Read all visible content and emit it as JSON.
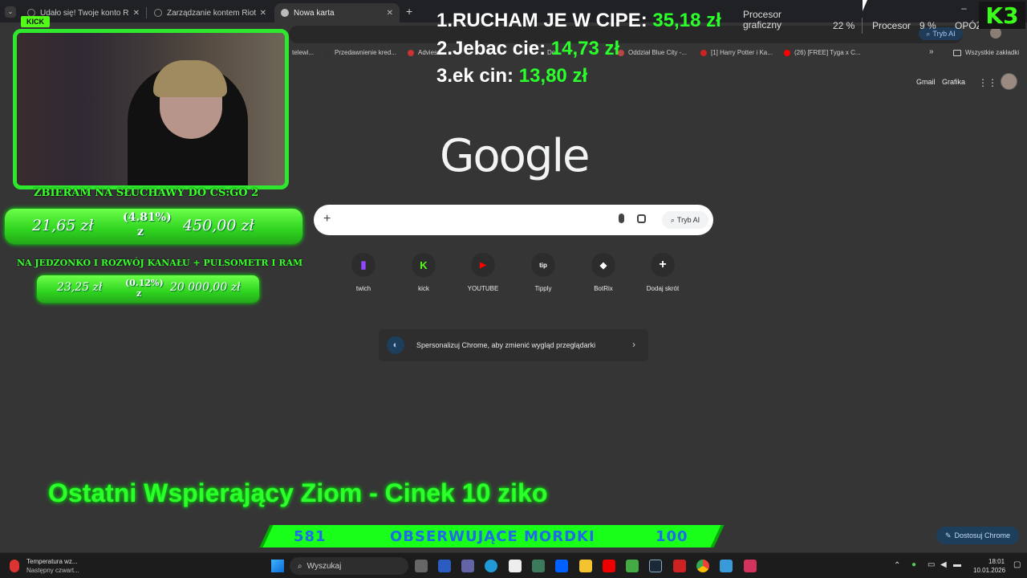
{
  "tabs": [
    {
      "label": "Udało się! Twoje konto Riot jest",
      "active": false
    },
    {
      "label": "Zarządzanie kontem Riot",
      "active": false
    },
    {
      "label": "Nowa karta",
      "active": true
    }
  ],
  "toolbar": {
    "ai_mode_label": "Tryb AI"
  },
  "bookmarks": {
    "items": [
      {
        "label": "telewi..."
      },
      {
        "label": "Przedawnienie kred..."
      },
      {
        "label": "Advies"
      },
      {
        "label": "De..."
      },
      {
        "label": "Oddział Blue City -..."
      },
      {
        "label": "[1] Harry Potter i Ka..."
      },
      {
        "label": "(26) [FREE] Tyga x C..."
      }
    ],
    "all_bookmarks": "Wszystkie zakładki"
  },
  "google": {
    "gmail": "Gmail",
    "images": "Grafika",
    "logo": "Google",
    "ai_mode": "Tryb AI",
    "shortcuts": [
      {
        "label": "twich",
        "icon": "twitch-icon",
        "glyph": "▮",
        "color": "#9146ff"
      },
      {
        "label": "kick",
        "icon": "kick-icon",
        "glyph": "K",
        "color": "#53fc18"
      },
      {
        "label": "YOUTUBE",
        "icon": "youtube-icon",
        "glyph": "▶",
        "color": "#ff0000"
      },
      {
        "label": "Tipply",
        "icon": "tipply-icon",
        "glyph": "tip",
        "color": "#ffffff"
      },
      {
        "label": "BotRix",
        "icon": "botrix-icon",
        "glyph": "◆",
        "color": "#ffffff"
      },
      {
        "label": "Dodaj skrót",
        "icon": "plus-icon",
        "glyph": "+",
        "color": "#ffffff"
      }
    ],
    "personalize_text": "Spersonalizuj Chrome, aby zmienić wygląd przeglądarki",
    "customize_label": "Dostosuj Chrome"
  },
  "overlay": {
    "kick_badge": "KICK",
    "leaders": [
      {
        "rank": "1.",
        "name": "RUCHAM JE W CIPE:",
        "amount": "35,18 zł"
      },
      {
        "rank": "2.",
        "name": "Jebac cie:",
        "amount": "14,73 zł"
      },
      {
        "rank": "3.",
        "name": "ek cin:",
        "amount": "13,80 zł"
      }
    ],
    "goal1": {
      "title": "ZBIERAM NA SŁUCHAWY DO CS:GO 2",
      "current": "21,65 zł",
      "percent": "(4.81%)",
      "target": "450,00 zł",
      "unit": "z",
      "progress": 0.0481
    },
    "goal2": {
      "title": "NA JEDZONKO I ROZWÓJ KANAŁU + PULSOMETR I RAM",
      "current": "23,25 zł",
      "percent": "(0.12%)",
      "target": "20 000,00 zł",
      "unit": "z",
      "progress": 0.0012
    },
    "last_supporter": "Ostatni Wspierający Ziom - Cinek 10 ziko",
    "followers": {
      "current": "581",
      "label": "OBSERWUJĄCE MORDKI",
      "target": "100"
    },
    "logo": "K3"
  },
  "perf": {
    "gpu_label": "Procesor graficzny",
    "gpu_value": "22 %",
    "cpu_label": "Procesor",
    "cpu_value": "9 %",
    "extra": "OPÓŹ"
  },
  "taskbar": {
    "weather_title": "Temperatura wz...",
    "weather_sub": "Następny czwart...",
    "search": "Wyszukaj",
    "time": "18:01",
    "date": "10.01.2026"
  }
}
